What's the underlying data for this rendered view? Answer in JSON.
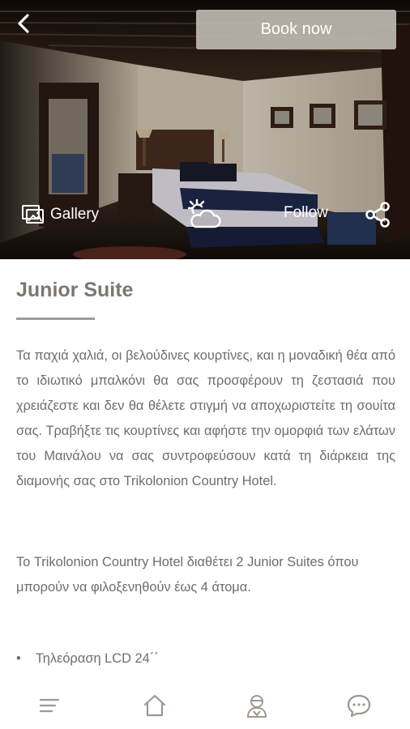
{
  "header": {
    "book_label": "Book now",
    "gallery_label": "Gallery",
    "follow_label": "Follow"
  },
  "content": {
    "title": "Junior Suite",
    "paragraph1": "Τα παχιά χαλιά, οι βελούδινες κουρτίνες, και η μοναδική θέα από το ιδιωτικό μπαλκόνι θα σας προσφέρουν τη ζεστασιά που χρειάζεστε και δεν θα θέλετε στιγμή να αποχωριστείτε τη σουίτα σας. Τραβήξτε τις κουρτίνες και αφήστε την ομορφιά των ελάτων του Μαινάλου να σας συντροφεύσουν κατά τη διάρκεια της διαμονής σας στο Trikolonion Country Hotel.",
    "paragraph2": "Το Trikolonion Country Hotel διαθέτει 2 Junior Suites όπου μπορούν να φιλοξενηθούν έως 4 άτομα.",
    "amenities": [
      "Τηλεόραση LCD 24΄΄"
    ]
  },
  "bottom_nav": {
    "icons": [
      "menu-icon",
      "home-icon",
      "concierge-icon",
      "chat-icon"
    ]
  },
  "colors": {
    "accent": "#beb9b0",
    "title": "#7d7770",
    "text": "#6d6d6d",
    "nav_icon": "#9e9891"
  }
}
